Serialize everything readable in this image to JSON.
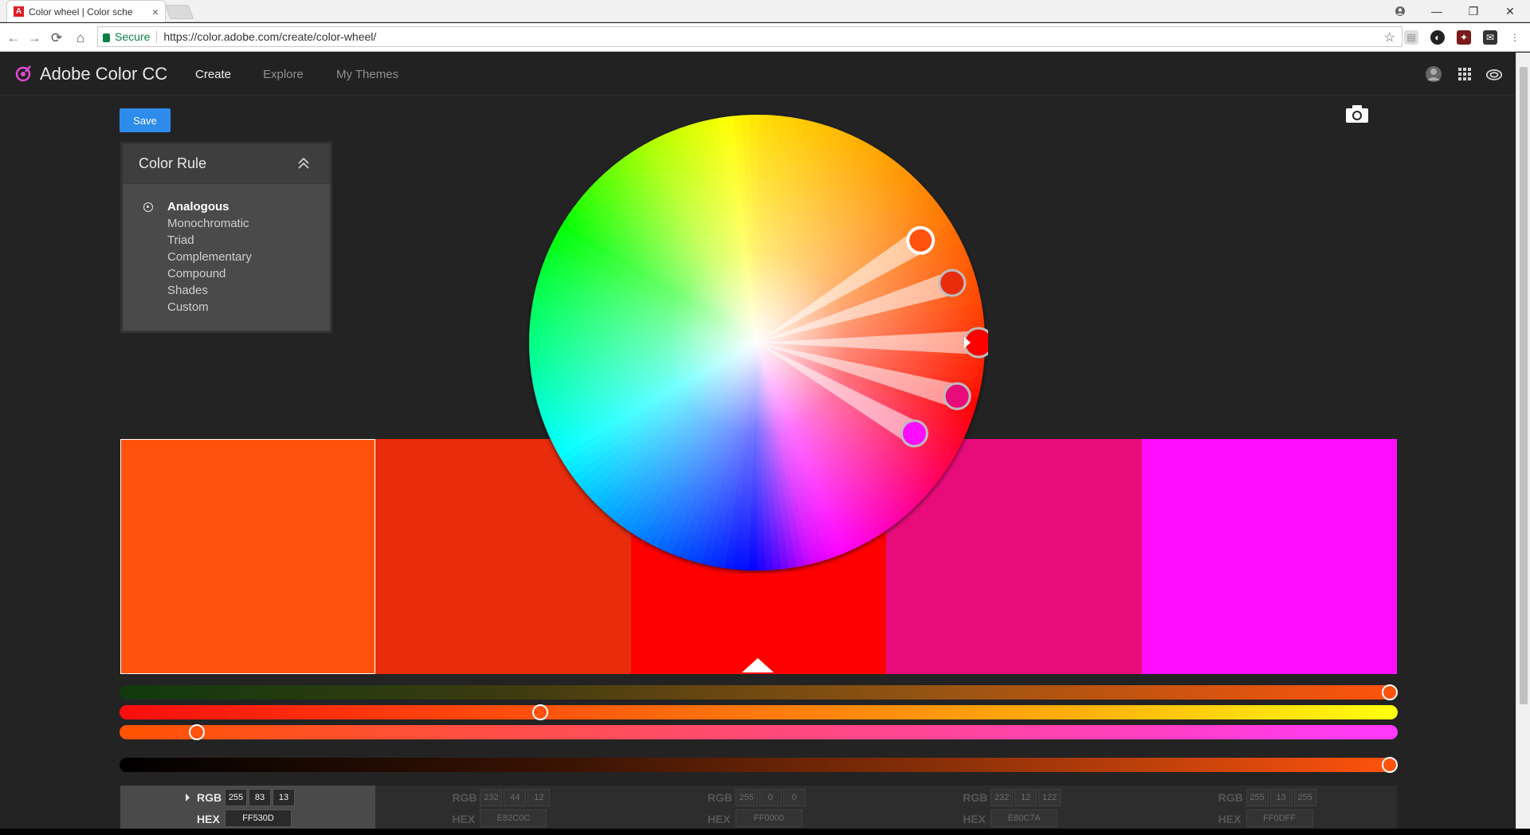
{
  "browser": {
    "tab_title": "Color wheel | Color sche",
    "tab_close": "×",
    "secure_label": "Secure",
    "url": "https://color.adobe.com/create/color-wheel/",
    "window_controls": [
      "—",
      "❐",
      "✕"
    ]
  },
  "app": {
    "brand": "Adobe Color CC",
    "nav": [
      {
        "label": "Create",
        "active": true
      },
      {
        "label": "Explore",
        "active": false
      },
      {
        "label": "My Themes",
        "active": false
      }
    ],
    "save_label": "Save",
    "header_icons": [
      "avatar",
      "apps-grid-icon",
      "creative-cloud-icon"
    ]
  },
  "color_rule": {
    "title": "Color Rule",
    "items": [
      {
        "label": "Analogous",
        "selected": true
      },
      {
        "label": "Monochromatic",
        "selected": false
      },
      {
        "label": "Triad",
        "selected": false
      },
      {
        "label": "Complementary",
        "selected": false
      },
      {
        "label": "Compound",
        "selected": false
      },
      {
        "label": "Shades",
        "selected": false
      },
      {
        "label": "Custom",
        "selected": false
      }
    ]
  },
  "swatches": [
    {
      "hex": "#FF530D",
      "rgb": [
        "255",
        "83",
        "13"
      ],
      "hex_label": "FF530D",
      "base": true
    },
    {
      "hex": "#E82C0C",
      "rgb": [
        "232",
        "44",
        "12"
      ],
      "hex_label": "E82C0C",
      "base": false
    },
    {
      "hex": "#FF0000",
      "rgb": [
        "255",
        "0",
        "0"
      ],
      "hex_label": "FF0000",
      "base": false
    },
    {
      "hex": "#E80C7A",
      "rgb": [
        "232",
        "12",
        "122"
      ],
      "hex_label": "E80C7A",
      "base": false
    },
    {
      "hex": "#FF0DFF",
      "rgb": [
        "255",
        "13",
        "255"
      ],
      "hex_label": "FF0DFF",
      "base": false
    }
  ],
  "labels": {
    "rgb": "RGB",
    "hex": "HEX"
  },
  "sliders": {
    "values": [
      1.0,
      0.327,
      0.055,
      1.0
    ]
  }
}
